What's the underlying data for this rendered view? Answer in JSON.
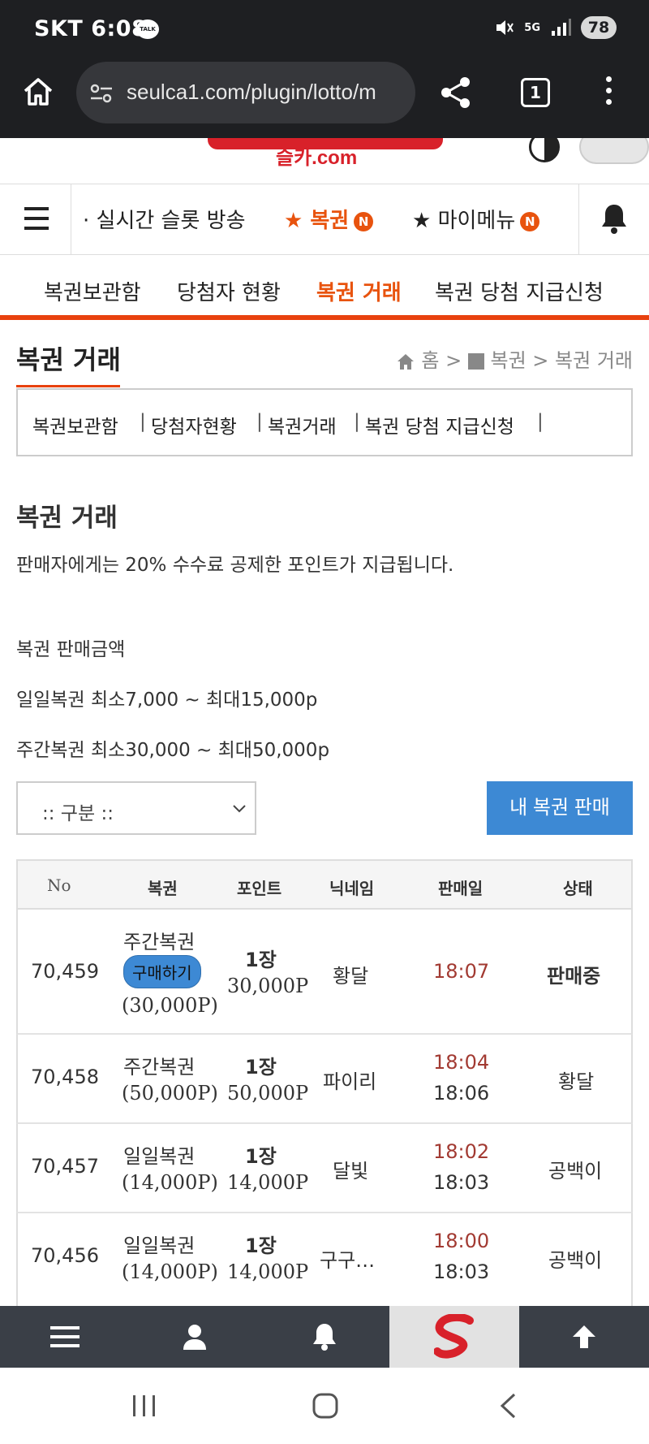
{
  "status_bar": {
    "carrier": "SKT",
    "time": "6:08",
    "talk_badge": "TALK",
    "network": "5G",
    "battery": "78"
  },
  "browser": {
    "url": "seulca1.com/plugin/lotto/m",
    "tab_count": "1"
  },
  "site": {
    "logo_text": "슬카.com"
  },
  "menubar": {
    "items": [
      {
        "label": "· 실시간 슬롯 방송"
      },
      {
        "label": "★ 복권",
        "badge": "N"
      },
      {
        "label": "★ 마이메뉴",
        "badge": "N"
      }
    ]
  },
  "subnav": [
    "복권보관함",
    "당첨자 현황",
    "복권 거래",
    "복권 당첨 지급신청"
  ],
  "page": {
    "title": "복권 거래",
    "breadcrumb": {
      "home": "홈",
      "sep": ">",
      "section": "복권",
      "current": "복권 거래"
    },
    "box_links": [
      "복권보관함",
      "당첨자현황",
      "복권거래",
      "복권 당첨 지급신청"
    ],
    "section_title": "복권 거래",
    "notice": "판매자에게는 20% 수수료 공제한 포인트가 지급됩니다.",
    "price_heading": "복권 판매금액",
    "daily_range": "일일복권 최소7,000 ~ 최대15,000p",
    "weekly_range": "주간복권 최소30,000 ~ 최대50,000p",
    "select_value": ":: 구분 ::",
    "sell_button": "내 복권 판매"
  },
  "table": {
    "headers": [
      "No",
      "복권",
      "포인트",
      "닉네임",
      "판매일",
      "상태"
    ],
    "rows": [
      {
        "no": "70,459",
        "type": "주간복권",
        "buy": "구매하기",
        "price": "(30,000P)",
        "qty": "1장",
        "points": "30,000P",
        "nickname": "황달",
        "sold": "18:07",
        "done": "",
        "status": "판매중"
      },
      {
        "no": "70,458",
        "type": "주간복권",
        "buy": "",
        "price": "(50,000P)",
        "qty": "1장",
        "points": "50,000P",
        "nickname": "파이리",
        "sold": "18:04",
        "done": "18:06",
        "status": "황달"
      },
      {
        "no": "70,457",
        "type": "일일복권",
        "buy": "",
        "price": "(14,000P)",
        "qty": "1장",
        "points": "14,000P",
        "nickname": "달빛",
        "sold": "18:02",
        "done": "18:03",
        "status": "공백이"
      },
      {
        "no": "70,456",
        "type": "일일복권",
        "buy": "",
        "price": "(14,000P)",
        "qty": "1장",
        "points": "14,000P",
        "nickname": "구구…",
        "sold": "18:00",
        "done": "18:03",
        "status": "공백이"
      }
    ]
  },
  "bottom_bar": {
    "icons": [
      "menu-icon",
      "user-icon",
      "bell-icon",
      "site-logo",
      "arrow-up-icon"
    ]
  },
  "colors": {
    "accent": "#e8530e",
    "button_blue": "#3d89d4",
    "time_red": "#a23a32",
    "chrome": "#1e1f22"
  }
}
